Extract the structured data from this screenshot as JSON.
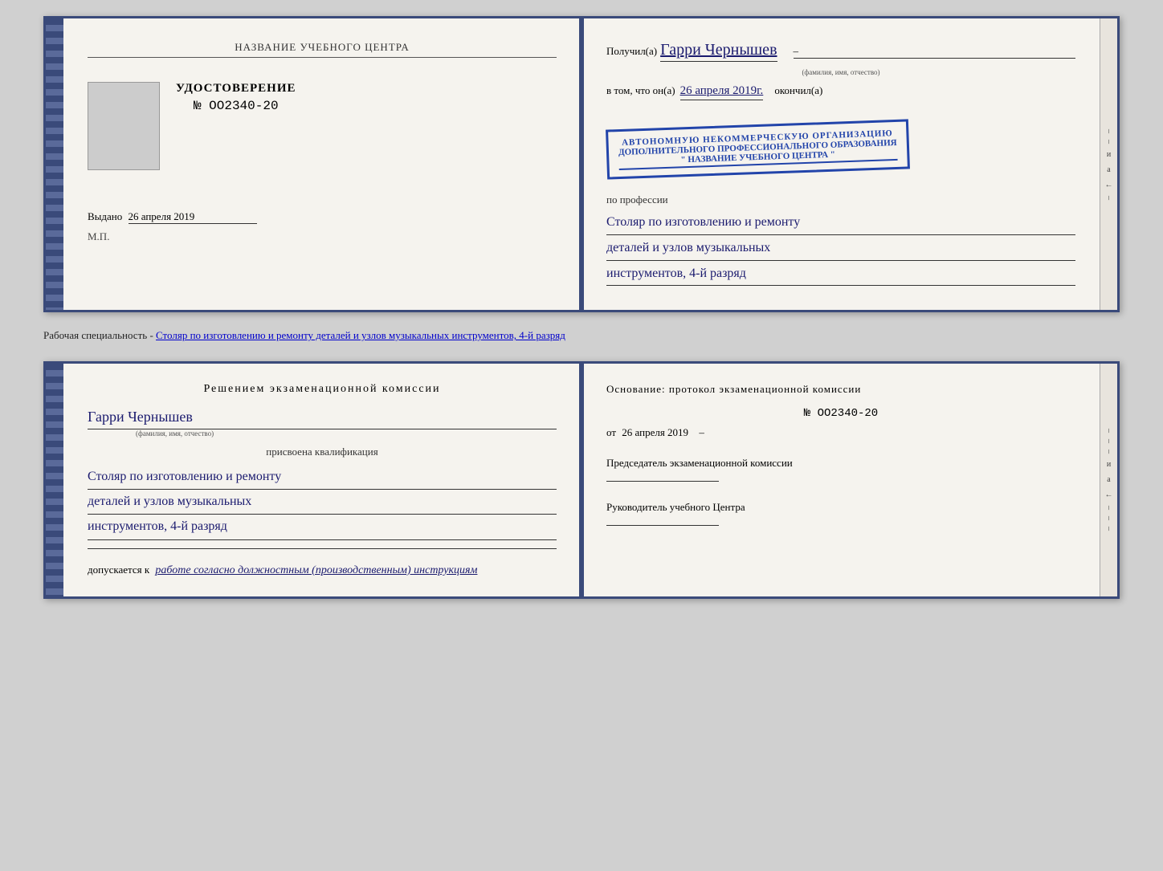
{
  "top_certificate": {
    "left": {
      "org_name": "НАЗВАНИЕ УЧЕБНОГО ЦЕНТРА",
      "cert_type": "УДОСТОВЕРЕНИЕ",
      "cert_number": "№ OO2340-20",
      "issued_label": "Выдано",
      "issued_date": "26 апреля 2019",
      "mp_label": "М.П."
    },
    "right": {
      "received_prefix": "Получил(а)",
      "person_name": "Гарри Чернышев",
      "name_label": "(фамилия, имя, отчество)",
      "date_prefix": "в том, что он(а)",
      "date_value": "26 апреля 2019г.",
      "finished_label": "окончил(а)",
      "stamp_line1": "АВТОНОМНУЮ НЕКОММЕРЧЕСКУЮ ОРГАНИЗАЦИЮ",
      "stamp_line2": "ДОПОЛНИТЕЛЬНОГО ПРОФЕССИОНАЛЬНОГО ОБРАЗОВАНИЯ",
      "stamp_line3": "\" НАЗВАНИЕ УЧЕБНОГО ЦЕНТРА \"",
      "profession_label": "по профессии",
      "profession_line1": "Столяр по изготовлению и ремонту",
      "profession_line2": "деталей и узлов музыкальных",
      "profession_line3": "инструментов, 4-й разряд"
    }
  },
  "caption": {
    "text": "Рабочая специальность - Столяр по изготовлению и ремонту деталей и узлов музыкальных инструментов, 4-й разряд"
  },
  "bottom_certificate": {
    "left": {
      "decision_title": "Решением  экзаменационной  комиссии",
      "person_name": "Гарри Чернышев",
      "name_label": "(фамилия, имя, отчество)",
      "assigned_label": "присвоена квалификация",
      "qual_line1": "Столяр по изготовлению и ремонту",
      "qual_line2": "деталей и узлов музыкальных",
      "qual_line3": "инструментов, 4-й разряд",
      "допуск_prefix": "допускается к",
      "допуск_text": "работе согласно должностным (производственным) инструкциям"
    },
    "right": {
      "basis_title": "Основание: протокол экзаменационной  комиссии",
      "number": "№  OO2340-20",
      "date_prefix": "от",
      "date_value": "26 апреля 2019",
      "chairman_title": "Председатель экзаменационной комиссии",
      "director_title": "Руководитель учебного Центра"
    }
  },
  "side_labels": {
    "и": "и",
    "а": "а",
    "left": "←"
  }
}
